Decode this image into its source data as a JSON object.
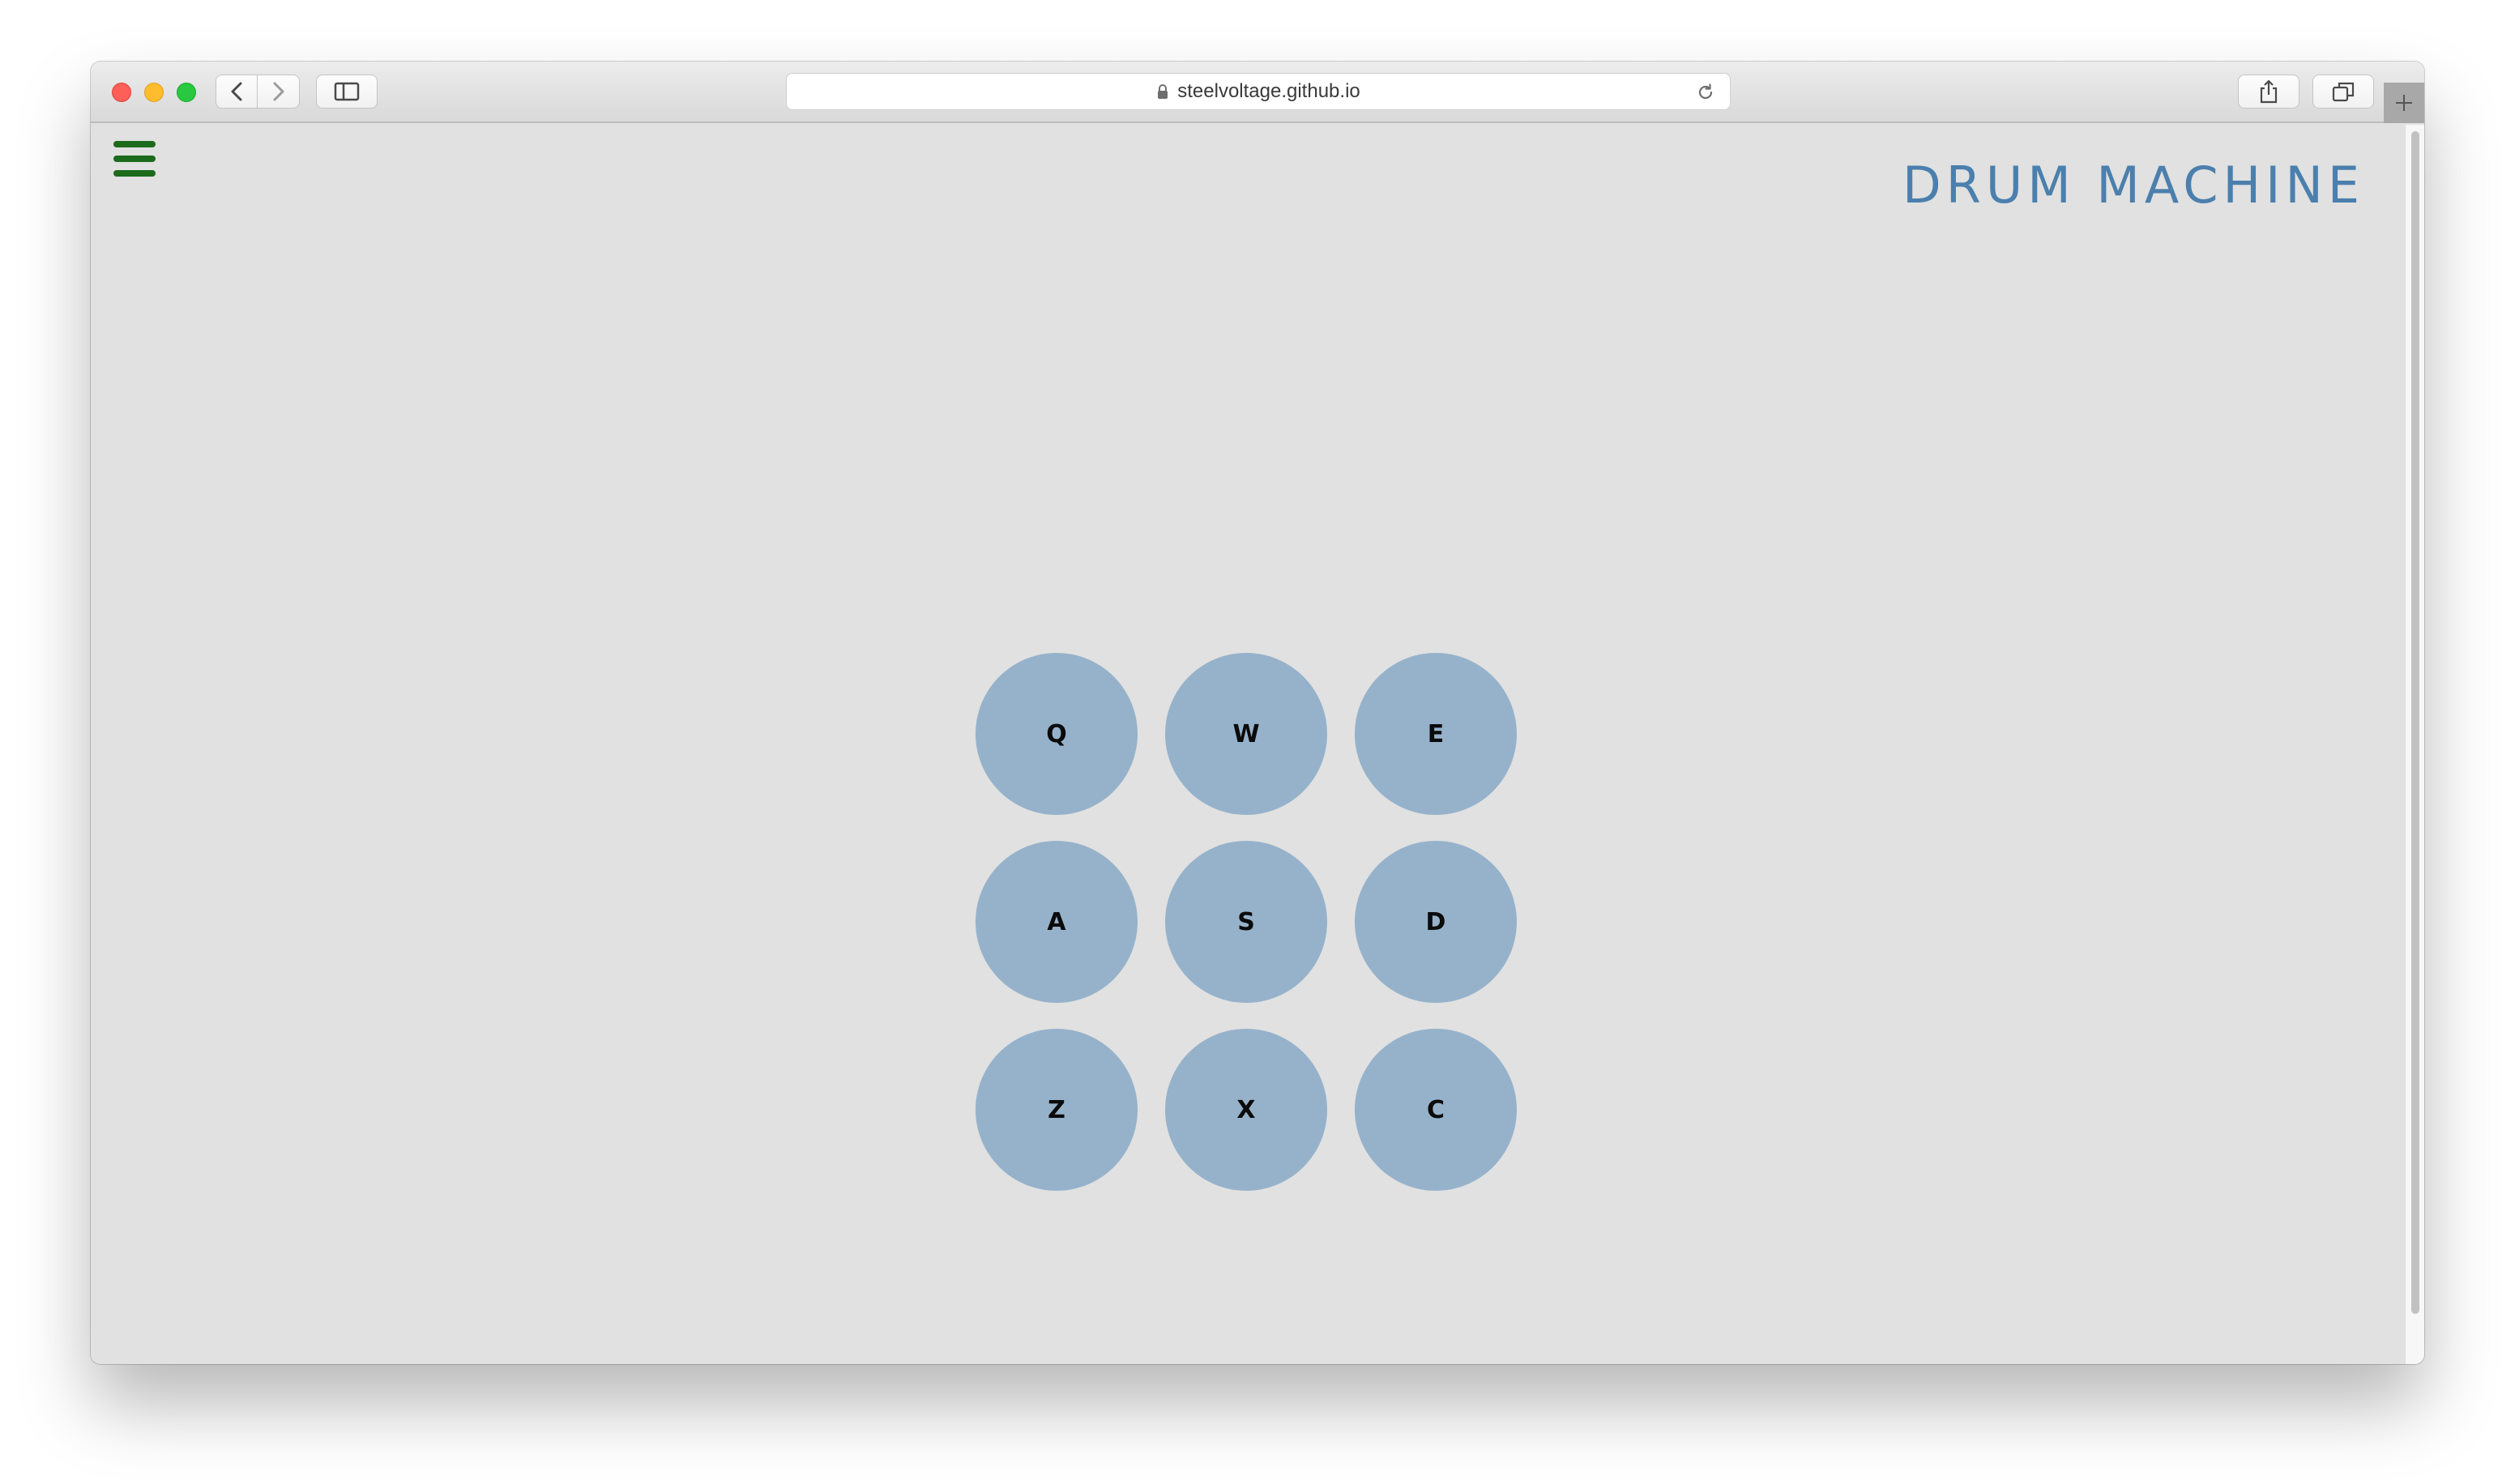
{
  "browser": {
    "url": "steelvoltage.github.io"
  },
  "page": {
    "title": "DRUM MACHINE"
  },
  "pads": [
    {
      "key": "Q"
    },
    {
      "key": "W"
    },
    {
      "key": "E"
    },
    {
      "key": "A"
    },
    {
      "key": "S"
    },
    {
      "key": "D"
    },
    {
      "key": "Z"
    },
    {
      "key": "X"
    },
    {
      "key": "C"
    }
  ],
  "colors": {
    "background": "#e1e1e1",
    "pad": "#96b2cb",
    "title": "#4b7fad",
    "menu": "#1c6b1c"
  },
  "icons": {
    "menu": "hamburger-menu-icon",
    "back": "chevron-left-icon",
    "forward": "chevron-right-icon",
    "sidebar": "sidebar-icon",
    "lock": "lock-icon",
    "reload": "reload-icon",
    "share": "share-icon",
    "tabs": "tabs-icon",
    "new_tab": "plus-icon"
  }
}
